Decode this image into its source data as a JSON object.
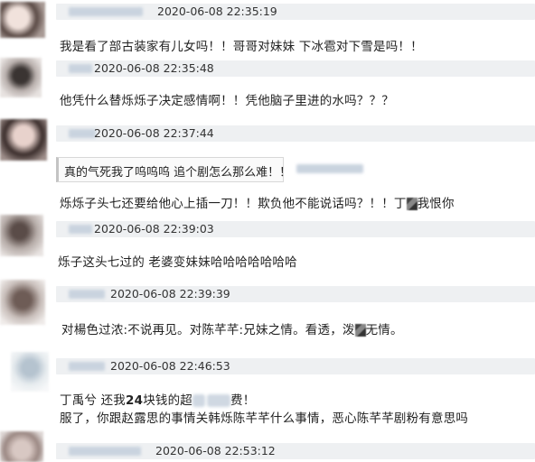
{
  "comments": [
    {
      "time": "2020-06-08 22:35:19",
      "lines": [
        "我是看了部古装家有儿女吗！！哥哥对妹妹 下冰雹对下雪是吗！！"
      ]
    },
    {
      "time": "2020-06-08 22:35:48",
      "lines": [
        "他凭什么替烁烁子决定感情啊！！凭他脑子里进的水吗？？？"
      ]
    },
    {
      "time": "2020-06-08 22:37:44",
      "quote": "真的气死我了呜呜呜 追个剧怎么那么难！！",
      "lines": [
        "烁烁子头七还要给他心上插一刀！！欺负他不能说话吗？！！丁",
        "我恨你"
      ]
    },
    {
      "time": "2020-06-08 22:39:03",
      "lines": [
        "烁子这头七过的 老婆变妹妹哈哈哈哈哈哈哈"
      ]
    },
    {
      "time": "2020-06-08 22:39:39",
      "lines": [
        "对楊色过浓:不说再见。对陈芊芊:兄妹之情。看透，泼",
        "无情。"
      ]
    },
    {
      "time": "2020-06-08 22:46:53",
      "lines": [
        "丁禹兮 还我",
        "24",
        "块钱的超",
        "费！",
        "服了，你跟赵露思的事情关韩烁陈芊芊什么事情，恶心陈芊芊剧粉有意思吗"
      ]
    },
    {
      "time": "2020-06-08 22:53:12",
      "lines": []
    }
  ],
  "colors": {
    "meta_bg": "#eef0f2",
    "text": "#222222",
    "name_blur": "#c9d3df"
  }
}
